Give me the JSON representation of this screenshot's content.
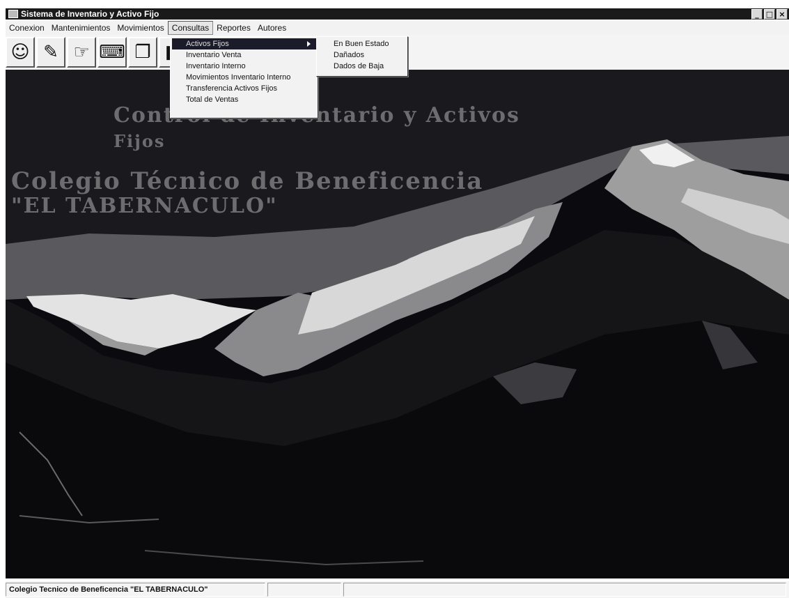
{
  "window": {
    "title": "Sistema de Inventario y Activo Fijo",
    "controls": [
      "_",
      "□",
      "×"
    ]
  },
  "menubar": {
    "items": [
      {
        "label": "Conexion"
      },
      {
        "label": "Mantenimientos"
      },
      {
        "label": "Movimientos"
      },
      {
        "label": "Consultas",
        "active": true
      },
      {
        "label": "Reportes"
      },
      {
        "label": "Autores"
      }
    ]
  },
  "toolbar": {
    "buttons": [
      {
        "icon": "smiley-icon",
        "glyph": "☺"
      },
      {
        "icon": "edit-icon",
        "glyph": "✎"
      },
      {
        "icon": "hand-icon",
        "glyph": "☞"
      },
      {
        "icon": "computer-icon",
        "glyph": "⌨"
      },
      {
        "icon": "documents-icon",
        "glyph": "❐"
      },
      {
        "icon": "book-icon",
        "glyph": "■"
      }
    ]
  },
  "consultas_menu": {
    "items": [
      {
        "label": "Activos Fijos",
        "has_submenu": true,
        "highlighted": true
      },
      {
        "label": "Inventario Venta"
      },
      {
        "label": "Inventario Interno"
      },
      {
        "label": "Movimientos Inventario Interno"
      },
      {
        "label": "Transferencia Activos Fijos"
      },
      {
        "label": "Total de Ventas"
      }
    ]
  },
  "activos_submenu": {
    "items": [
      {
        "label": "En Buen Estado"
      },
      {
        "label": "Dañados"
      },
      {
        "label": "Dados de Baja"
      }
    ]
  },
  "background": {
    "line1": "Control de Inventario y Activos",
    "line2": "Fijos",
    "line3": "Colegio Técnico de Beneficencia",
    "line4": "\"EL TABERNACULO\""
  },
  "statusbar": {
    "panel1": "Colegio Tecnico de Beneficencia \"EL TABERNACULO\"",
    "panel2": "",
    "panel3": ""
  }
}
